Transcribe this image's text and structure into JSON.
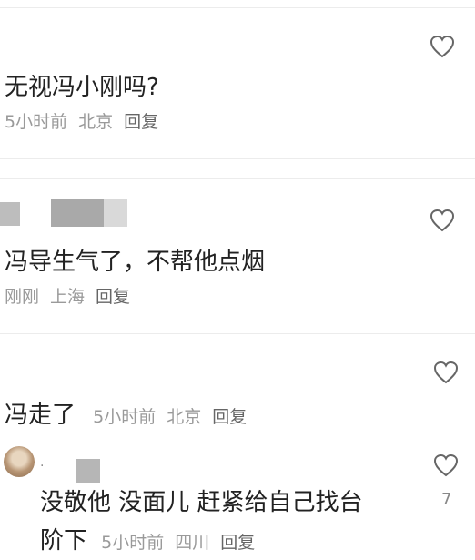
{
  "comments": [
    {
      "text": "无视冯小刚吗?",
      "time": "5小时前",
      "location": "北京",
      "reply": "回复"
    },
    {
      "text": "冯导生气了，不帮他点烟",
      "time": "刚刚",
      "location": "上海",
      "reply": "回复"
    },
    {
      "text": "冯走了",
      "time": "5小时前",
      "location": "北京",
      "reply": "回复"
    },
    {
      "text_line1": "没敬他 没面儿 赶紧给自己找台",
      "text_line2": "阶下",
      "time": "5小时前",
      "location": "四川",
      "reply": "回复",
      "like_count": "7",
      "username_dot": "·"
    }
  ],
  "icons": {
    "like": "heart-outline-icon",
    "avatar": "user-avatar"
  },
  "colors": {
    "text": "#222222",
    "meta": "#9a9a9a",
    "divider": "#ececec",
    "heart": "#666666"
  }
}
